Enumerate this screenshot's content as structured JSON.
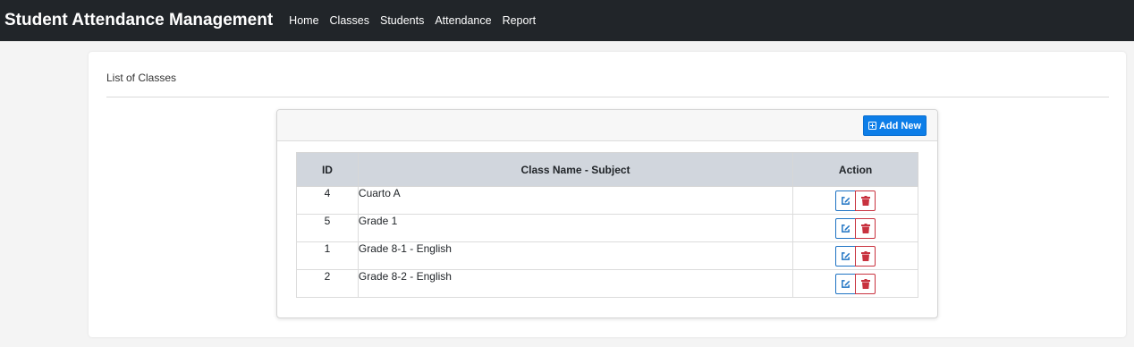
{
  "navbar": {
    "brand": "Student Attendance Management",
    "links": [
      {
        "label": "Home"
      },
      {
        "label": "Classes"
      },
      {
        "label": "Students"
      },
      {
        "label": "Attendance"
      },
      {
        "label": "Report"
      }
    ]
  },
  "page": {
    "title": "List of Classes"
  },
  "card": {
    "add_label": "Add New",
    "add_icon": "plus-square-icon"
  },
  "table": {
    "columns": [
      "ID",
      "Class Name - Subject",
      "Action"
    ],
    "rows": [
      {
        "id": "4",
        "name": "Cuarto A"
      },
      {
        "id": "5",
        "name": "Grade 1"
      },
      {
        "id": "1",
        "name": "Grade 8-1 - English"
      },
      {
        "id": "2",
        "name": "Grade 8-2 - English"
      }
    ],
    "row_actions": [
      {
        "icon": "edit-icon",
        "color": "#1f73c3"
      },
      {
        "icon": "trash-icon",
        "color": "#c8323f"
      }
    ]
  },
  "colors": {
    "navbar_bg": "#212529",
    "primary": "#0d7ee8",
    "danger": "#c8323f",
    "table_header_bg": "#d1d6dd"
  }
}
